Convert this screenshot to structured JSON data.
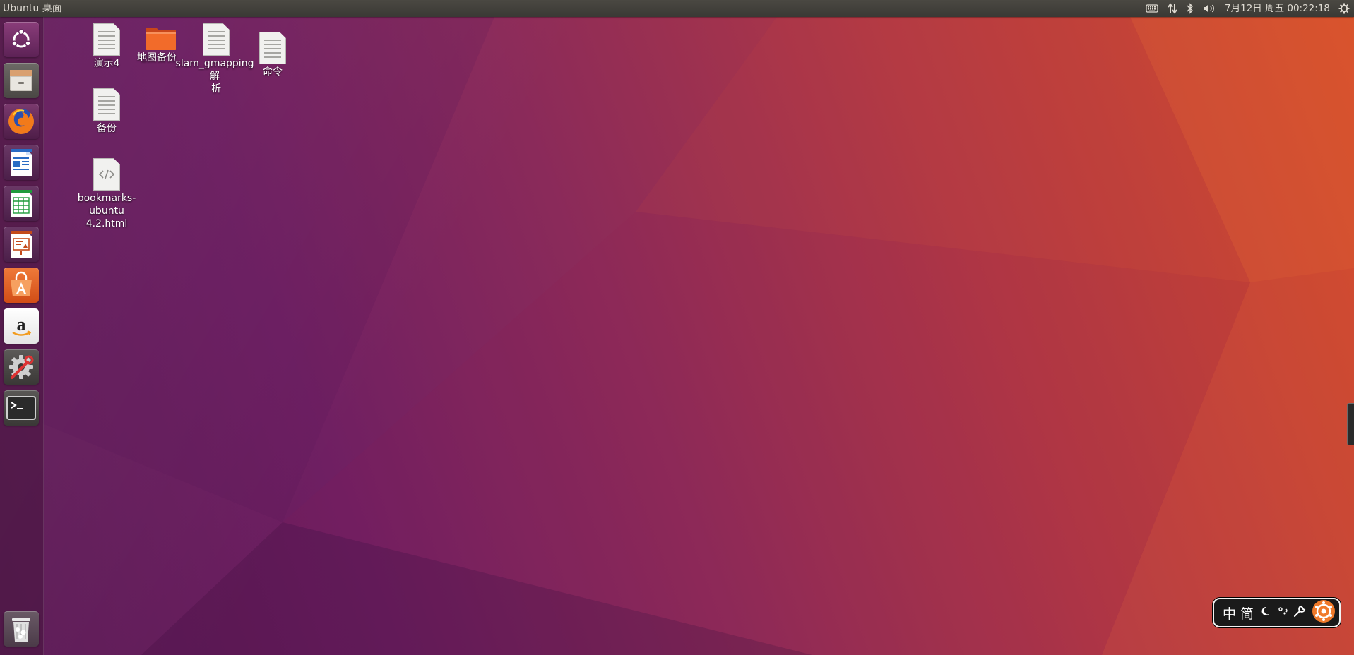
{
  "top_panel": {
    "title": "Ubuntu 桌面",
    "clock": "7月12日 周五 00:22:18",
    "indicators": [
      "keyboard-icon",
      "network-icon",
      "bluetooth-icon",
      "volume-icon",
      "session-gear-icon"
    ]
  },
  "launcher": {
    "items": [
      {
        "name": "dash-home",
        "icon": "ubuntu-logo-icon"
      },
      {
        "name": "files",
        "icon": "file-cabinet-icon"
      },
      {
        "name": "firefox",
        "icon": "firefox-icon"
      },
      {
        "name": "libreoffice-writer",
        "icon": "writer-icon"
      },
      {
        "name": "libreoffice-calc",
        "icon": "calc-icon"
      },
      {
        "name": "libreoffice-impress",
        "icon": "impress-icon"
      },
      {
        "name": "ubuntu-software",
        "icon": "software-center-icon"
      },
      {
        "name": "amazon",
        "icon": "amazon-icon"
      },
      {
        "name": "system-settings",
        "icon": "settings-icon"
      },
      {
        "name": "terminal",
        "icon": "terminal-icon"
      }
    ],
    "trash": {
      "icon": "trash-icon"
    }
  },
  "desktop_icons": {
    "yanshi4": "演示4",
    "ditu_beifen": "地图备份",
    "slam_line1": "slam_gmapping解",
    "slam_line2": "析",
    "mingling": "命令",
    "beifen": "备份",
    "bookmarks_line1": "bookmarks-ubuntu",
    "bookmarks_line2": "4.2.html"
  },
  "ime": {
    "lang": "中",
    "mode": "简",
    "icons": [
      "moon-icon",
      "punctuation-icon",
      "wrench-icon",
      "sogou-logo-icon"
    ]
  },
  "colors": {
    "panel": "#3c3b37",
    "accent_orange": "#e95420",
    "wallpaper_purple": "#6f1f62",
    "wallpaper_orange": "#d24b2a"
  }
}
